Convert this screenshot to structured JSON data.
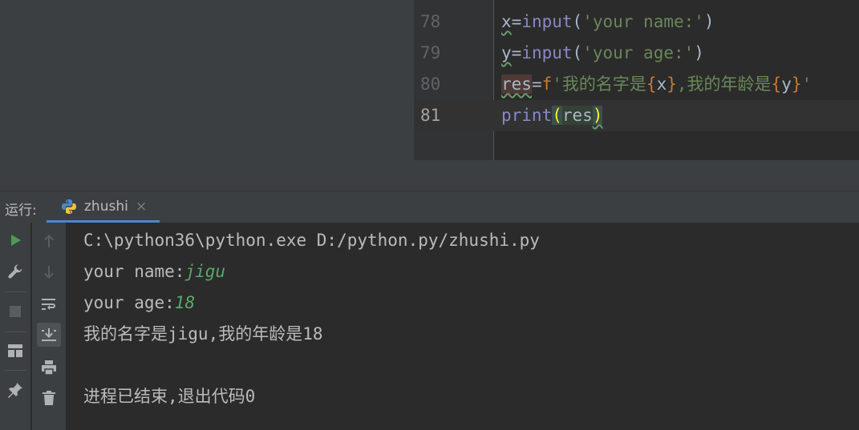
{
  "editor": {
    "lines": [
      {
        "number": "78",
        "tokens": [
          {
            "text": "x",
            "cls": "t-var squig"
          },
          {
            "text": "=",
            "cls": "t-op"
          },
          {
            "text": "input",
            "cls": "t-fn"
          },
          {
            "text": "(",
            "cls": "t-op"
          },
          {
            "text": "'your name:'",
            "cls": "t-str"
          },
          {
            "text": ")",
            "cls": "t-op"
          }
        ]
      },
      {
        "number": "79",
        "tokens": [
          {
            "text": "y",
            "cls": "t-var squig"
          },
          {
            "text": "=",
            "cls": "t-op"
          },
          {
            "text": "input",
            "cls": "t-fn"
          },
          {
            "text": "(",
            "cls": "t-op"
          },
          {
            "text": "'your age:'",
            "cls": "t-str"
          },
          {
            "text": ")",
            "cls": "t-op"
          }
        ]
      },
      {
        "number": "80",
        "tokens": [
          {
            "text": "res",
            "cls": "t-var t-redbg squig"
          },
          {
            "text": "=",
            "cls": "t-op"
          },
          {
            "text": "f",
            "cls": "t-fpref"
          },
          {
            "text": "'我的名字是",
            "cls": "t-str"
          },
          {
            "text": "{",
            "cls": "t-brace"
          },
          {
            "text": "x",
            "cls": "t-var"
          },
          {
            "text": "}",
            "cls": "t-brace"
          },
          {
            "text": ",我的年龄是",
            "cls": "t-str"
          },
          {
            "text": "{",
            "cls": "t-brace"
          },
          {
            "text": "y",
            "cls": "t-var"
          },
          {
            "text": "}",
            "cls": "t-brace"
          },
          {
            "text": "'",
            "cls": "t-str"
          }
        ]
      },
      {
        "number": "81",
        "current": true,
        "tokens": [
          {
            "text": "print",
            "cls": "t-fn"
          },
          {
            "text": "(",
            "cls": "t-paren-hl"
          },
          {
            "text": "res",
            "cls": "t-var t-sel"
          },
          {
            "text": ")",
            "cls": "t-paren-hl squig"
          }
        ]
      }
    ]
  },
  "run_panel": {
    "label": "运行:",
    "tab_name": "zhushi",
    "tab_close": "×"
  },
  "console": {
    "command": "C:\\python36\\python.exe D:/python.py/zhushi.py",
    "prompt_name": "your name:",
    "input_name": "jigu",
    "prompt_age": "your age:",
    "input_age": "18",
    "output": "我的名字是jigu,我的年龄是18",
    "exit_message": "进程已结束,退出代码0"
  },
  "toolbar": {
    "left": [
      "run-icon",
      "wrench-icon",
      "stop-icon",
      "layout-icon",
      "pin-icon"
    ],
    "right": [
      "up-arrow-icon",
      "down-arrow-icon",
      "soft-wrap-icon",
      "scroll-to-end-icon",
      "print-icon",
      "trash-icon"
    ]
  },
  "colors": {
    "run_green": "#499c54",
    "tab_underline": "#4a88c7",
    "input_green": "#59a869",
    "string_green": "#6a8759",
    "function_purple": "#8888c6",
    "brace_orange": "#cc7832"
  }
}
